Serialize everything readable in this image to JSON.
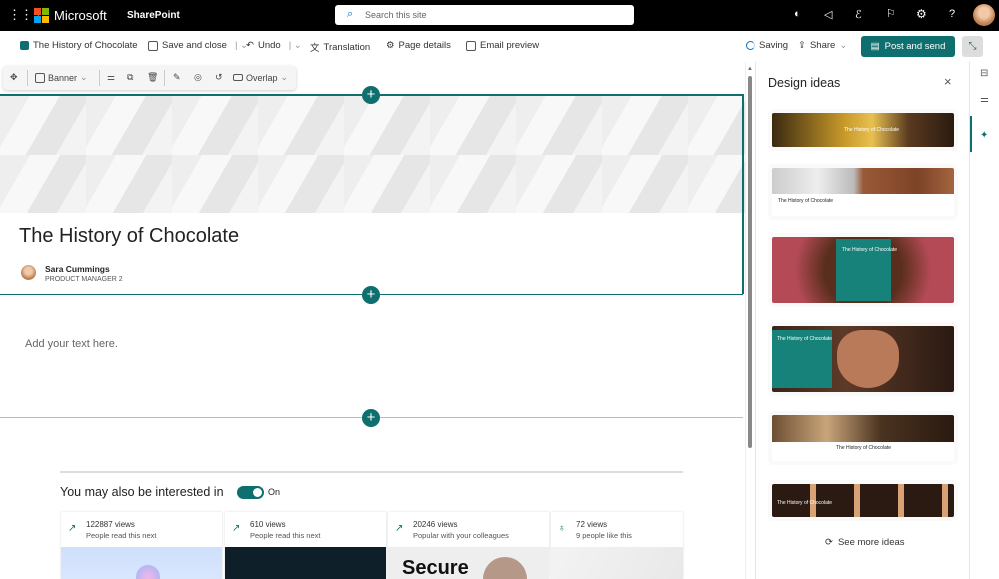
{
  "topbar": {
    "brand": "Microsoft",
    "app": "SharePoint",
    "search_placeholder": "Search this site"
  },
  "commandbar": {
    "page_name": "The History of Chocolate",
    "save_close": "Save and close",
    "undo": "Undo",
    "translation": "Translation",
    "page_details": "Page details",
    "email_preview": "Email preview",
    "saving": "Saving",
    "share": "Share",
    "post_send": "Post and send"
  },
  "section_toolbar": {
    "layout": "Banner",
    "overlap": "Overlap"
  },
  "page": {
    "title": "The History of Chocolate",
    "author": "Sara Cummings",
    "author_role": "PRODUCT MANAGER 2",
    "text_placeholder": "Add your text here."
  },
  "related": {
    "heading": "You may also be interested in",
    "toggle_label": "On",
    "toggle_on": true,
    "cards": [
      {
        "views": "122887 views",
        "desc": "People read this next",
        "icon": "trending-icon"
      },
      {
        "views": "610 views",
        "desc": "People read this next",
        "icon": "trending-icon"
      },
      {
        "views": "20246 views",
        "desc": "Popular with your colleagues",
        "icon": "trending-icon",
        "image_text": "Secure"
      },
      {
        "views": "72 views",
        "desc": "9 people like this",
        "icon": "like-icon"
      }
    ]
  },
  "design_panel": {
    "title": "Design ideas",
    "thumb_title": "The History of Chocolate",
    "see_more": "See more ideas"
  },
  "colors": {
    "accent": "#0f6e6e",
    "topbar": "#000000"
  }
}
